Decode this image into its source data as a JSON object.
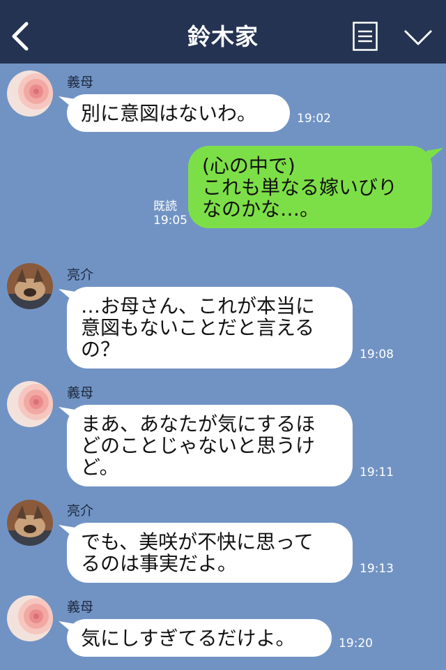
{
  "header": {
    "title": "鈴木家",
    "back_icon": "chevron-left-icon",
    "menu_icon": "list-icon",
    "expand_icon": "chevron-down-icon"
  },
  "messages": [
    {
      "sender": "義母",
      "text": "別に意図はないわ。",
      "time": "19:02"
    },
    {
      "sender": "",
      "read": "既読",
      "text": "(心の中で)\nこれも単なる嫁いびり\nなのかな…。",
      "time": "19:05"
    },
    {
      "sender": "亮介",
      "text": "…お母さん、これが本当に\n意図もないことだと言える\nの？",
      "time": "19:08"
    },
    {
      "sender": "義母",
      "text": "まあ、あなたが気にするほ\nどのことじゃないと思うけ\nど。",
      "time": "19:11"
    },
    {
      "sender": "亮介",
      "text": "でも、美咲が不快に思って\nるのは事実だよ。",
      "time": "19:13"
    },
    {
      "sender": "義母",
      "text": "気にしすぎてるだけよ。",
      "time": "19:20"
    }
  ],
  "colors": {
    "header_bg": "#243352",
    "chat_bg": "#7193c4",
    "own_bubble": "#7ddf47",
    "other_bubble": "#ffffff"
  }
}
